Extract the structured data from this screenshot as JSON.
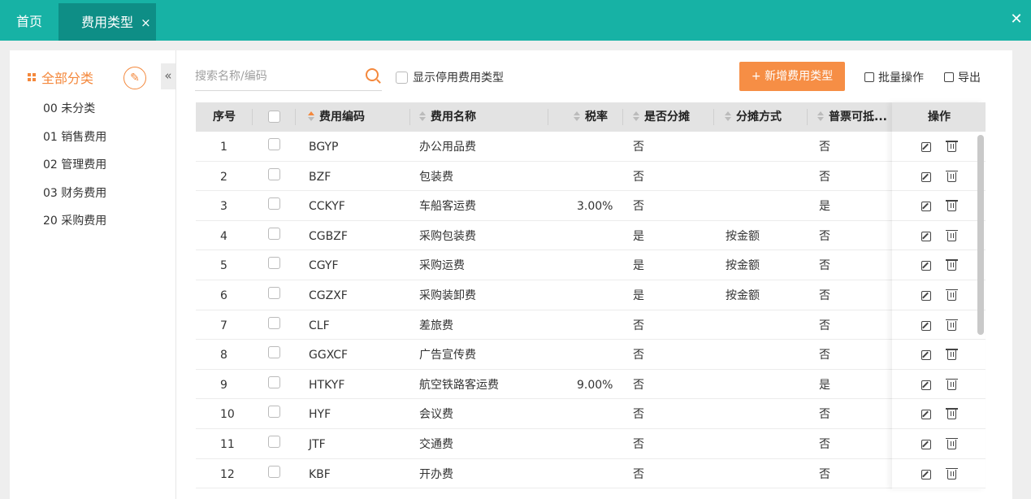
{
  "tabs": {
    "home": "首页",
    "active": "费用类型",
    "active_close": "×"
  },
  "window": {
    "close": "✕"
  },
  "sidebar": {
    "header": "全部分类",
    "collapse": "«",
    "categories": [
      "00 未分类",
      "01 销售费用",
      "02 管理费用",
      "03 财务费用",
      "20 采购费用"
    ]
  },
  "toolbar": {
    "search_placeholder": "搜索名称/编码",
    "show_disabled": "显示停用费用类型",
    "add_button": "+ 新增费用类型",
    "batch": "批量操作",
    "export": "导出"
  },
  "table": {
    "columns": {
      "seq": "序号",
      "code": "费用编码",
      "name": "费用名称",
      "tax": "税率",
      "share": "是否分摊",
      "method": "分摊方式",
      "invoice": "普票可抵...",
      "ops": "操作"
    },
    "rows": [
      {
        "seq": "1",
        "code": "BGYP",
        "name": "办公用品费",
        "tax": "",
        "share": "否",
        "method": "",
        "invoice": "否"
      },
      {
        "seq": "2",
        "code": "BZF",
        "name": "包装费",
        "tax": "",
        "share": "否",
        "method": "",
        "invoice": "否"
      },
      {
        "seq": "3",
        "code": "CCKYF",
        "name": "车船客运费",
        "tax": "3.00%",
        "share": "否",
        "method": "",
        "invoice": "是"
      },
      {
        "seq": "4",
        "code": "CGBZF",
        "name": "采购包装费",
        "tax": "",
        "share": "是",
        "method": "按金额",
        "invoice": "否"
      },
      {
        "seq": "5",
        "code": "CGYF",
        "name": "采购运费",
        "tax": "",
        "share": "是",
        "method": "按金额",
        "invoice": "否"
      },
      {
        "seq": "6",
        "code": "CGZXF",
        "name": "采购装卸费",
        "tax": "",
        "share": "是",
        "method": "按金额",
        "invoice": "否"
      },
      {
        "seq": "7",
        "code": "CLF",
        "name": "差旅费",
        "tax": "",
        "share": "否",
        "method": "",
        "invoice": "否"
      },
      {
        "seq": "8",
        "code": "GGXCF",
        "name": "广告宣传费",
        "tax": "",
        "share": "否",
        "method": "",
        "invoice": "否"
      },
      {
        "seq": "9",
        "code": "HTKYF",
        "name": "航空铁路客运费",
        "tax": "9.00%",
        "share": "否",
        "method": "",
        "invoice": "是"
      },
      {
        "seq": "10",
        "code": "HYF",
        "name": "会议费",
        "tax": "",
        "share": "否",
        "method": "",
        "invoice": "否"
      },
      {
        "seq": "11",
        "code": "JTF",
        "name": "交通费",
        "tax": "",
        "share": "否",
        "method": "",
        "invoice": "否"
      },
      {
        "seq": "12",
        "code": "KBF",
        "name": "开办费",
        "tax": "",
        "share": "否",
        "method": "",
        "invoice": "否"
      }
    ]
  },
  "colors": {
    "brand": "#17b2a5",
    "accent": "#f68e45"
  }
}
